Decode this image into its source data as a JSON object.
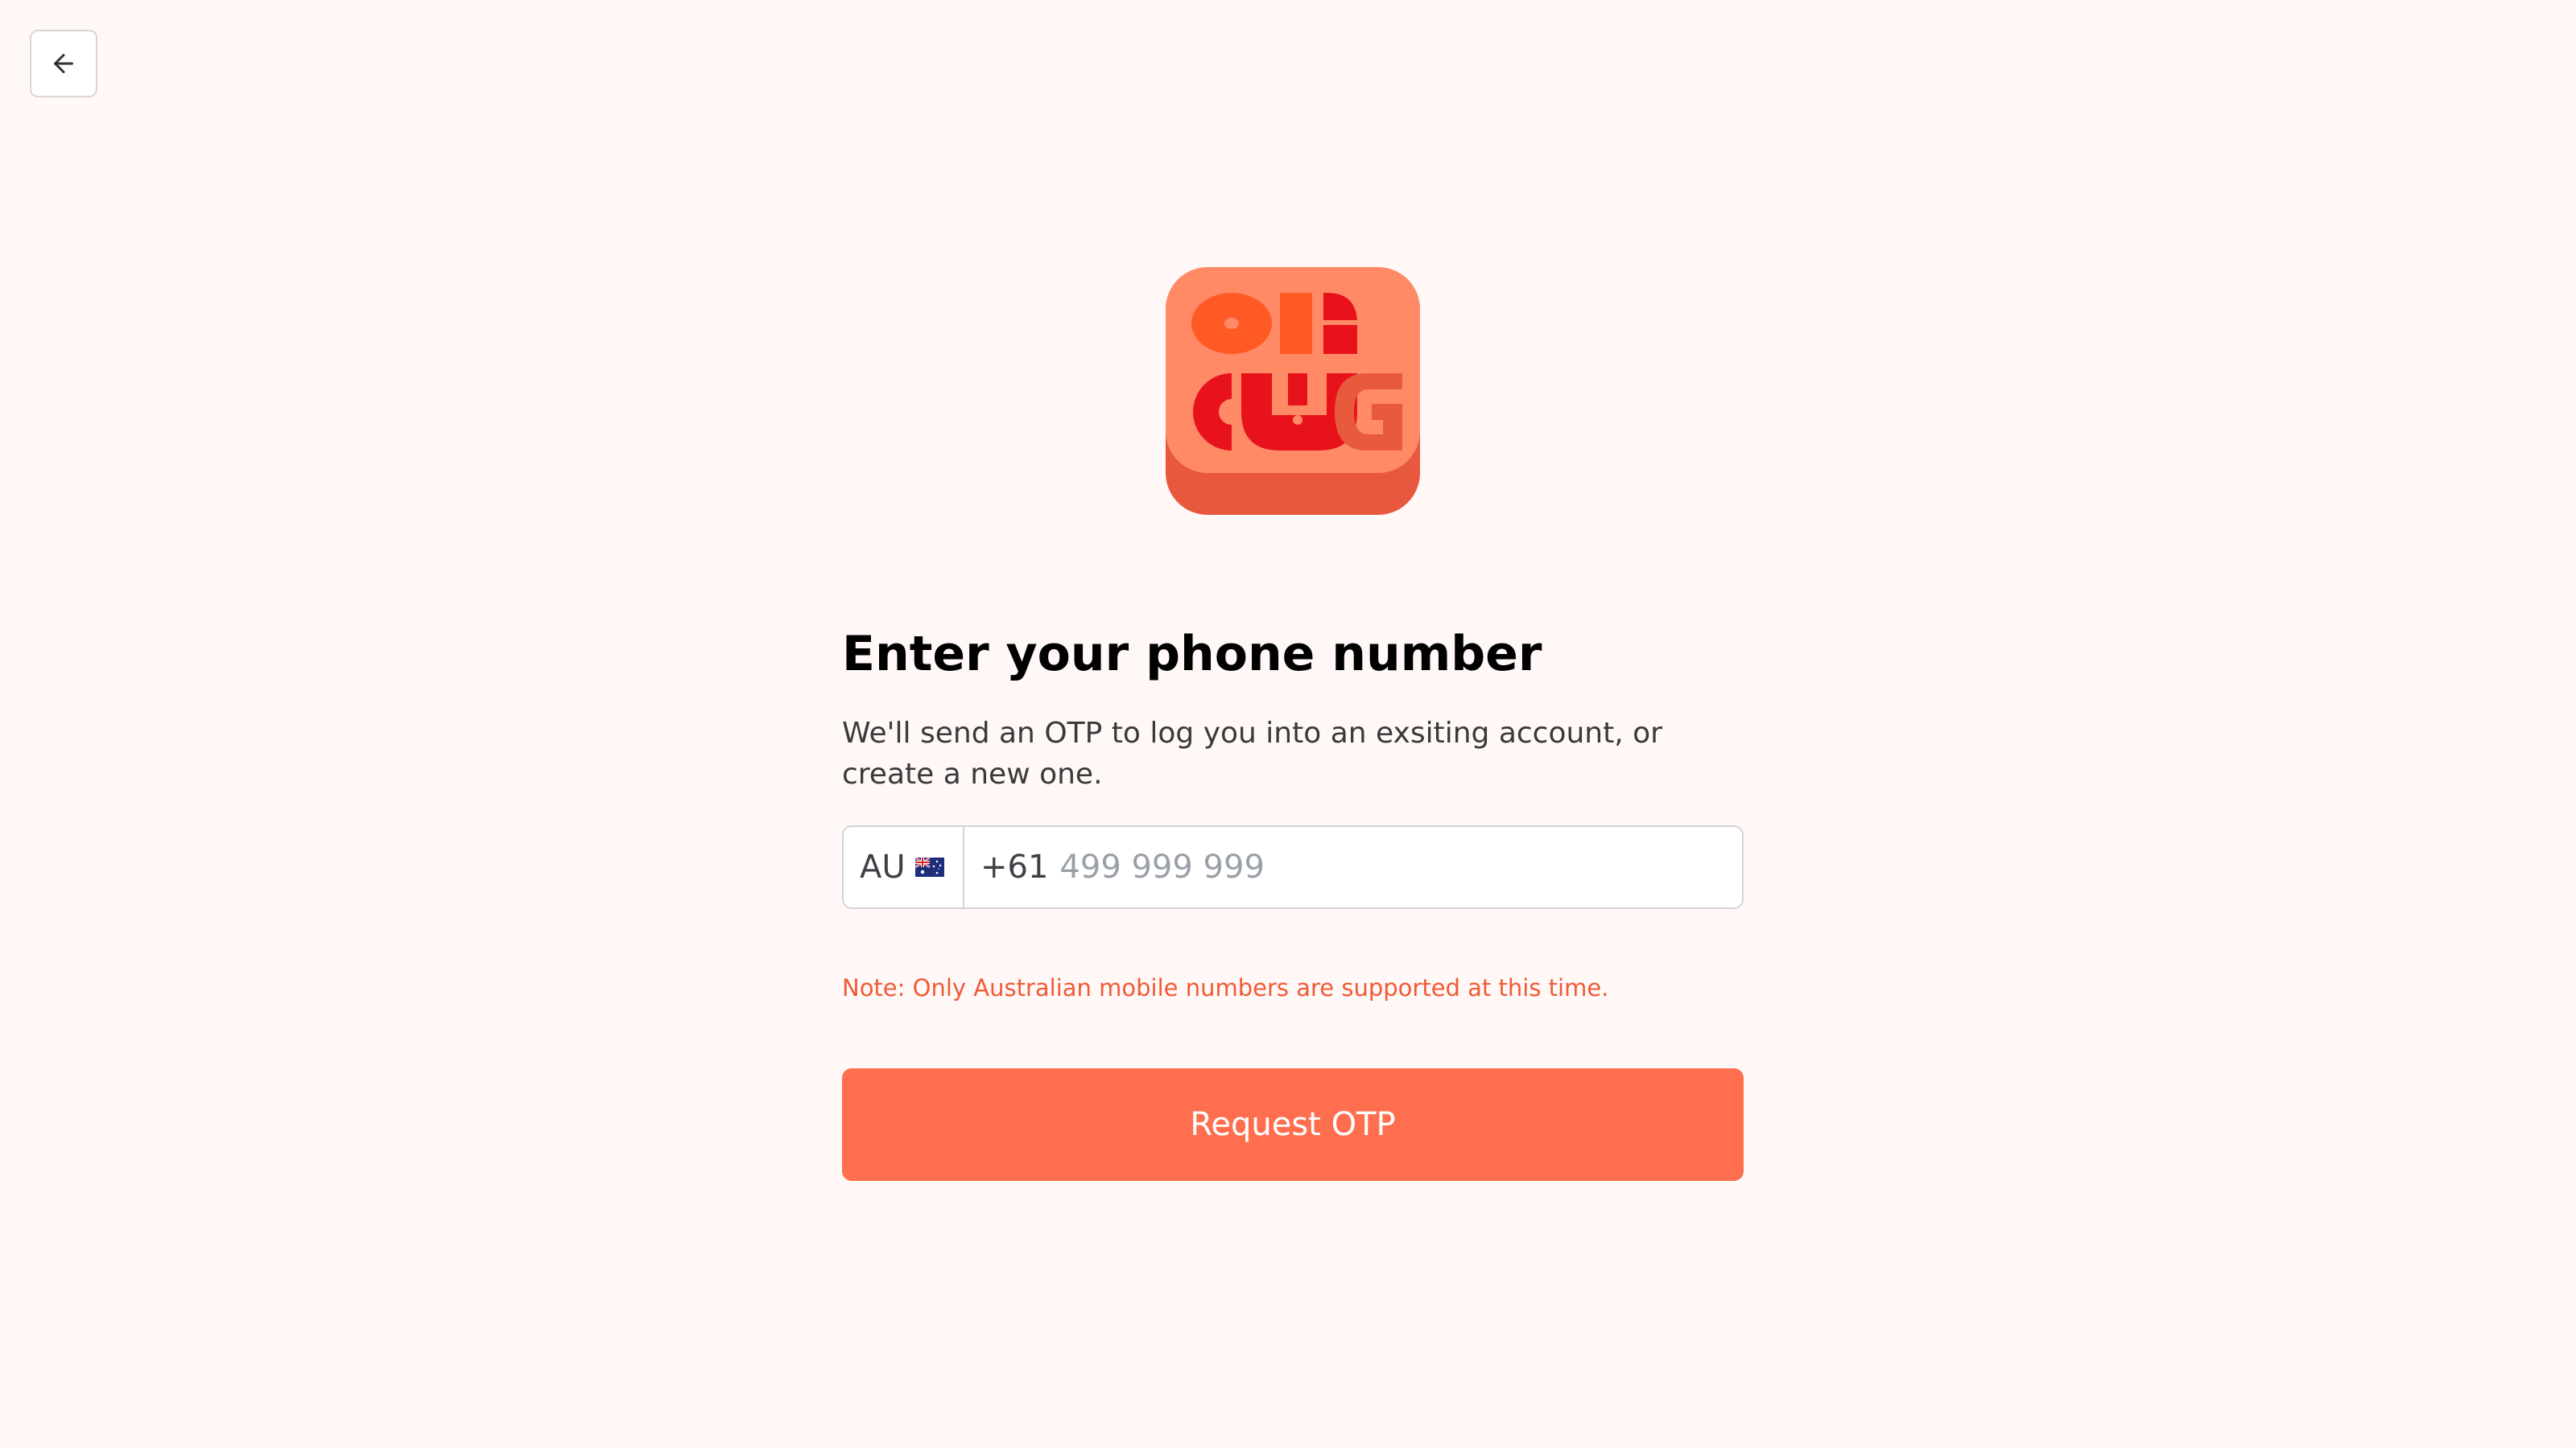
{
  "header": {
    "back_icon": "arrow-left-icon"
  },
  "logo": {
    "icon": "app-logo-icon",
    "colors": {
      "face": "#ff8a65",
      "base": "#e8583e",
      "shapes_orange": "#ff5a26",
      "shapes_red": "#e8121c"
    }
  },
  "form": {
    "title": "Enter your phone number",
    "subtitle": "We'll send an OTP to log you into an exsiting account, or create a new one.",
    "country": {
      "code": "AU",
      "flag_icon": "australia-flag-icon"
    },
    "phone": {
      "dial_code": "+61",
      "value": "",
      "placeholder": "499 999 999"
    },
    "note": "Note: Only Australian mobile numbers are supported at this time.",
    "submit_label": "Request OTP"
  },
  "colors": {
    "background": "#fff8f6",
    "accent": "#ff6f4f",
    "note": "#f05a36"
  }
}
